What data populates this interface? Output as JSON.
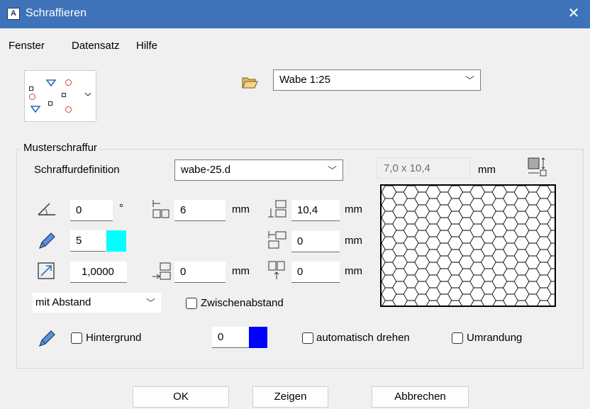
{
  "window": {
    "title": "Schraffieren",
    "app_icon": "A",
    "close_glyph": "✕"
  },
  "menu": [
    "Fenster",
    "Datensatz",
    "Hilfe"
  ],
  "preset": {
    "selected": "Wabe 1:25"
  },
  "group": {
    "title": "Musterschraffur",
    "definition_label": "Schraffurdefinition",
    "definition_value": "wabe-25.d",
    "size_value": "7,0 x 10,4",
    "size_unit": "mm"
  },
  "fields": {
    "angle": "0",
    "angle_unit": "°",
    "pen": "5",
    "scale": "1,0000",
    "width": "6",
    "width_unit": "mm",
    "offset": "0",
    "offset_unit": "mm",
    "height": "10,4",
    "height_unit": "mm",
    "spacing_x": "0",
    "spacing_x_unit": "mm",
    "spacing_y": "0",
    "spacing_y_unit": "mm"
  },
  "spacing_mode": "mit Abstand",
  "checkboxes": {
    "zwischenabstand": "Zwischenabstand",
    "hintergrund": "Hintergrund",
    "auto_rotate": "automatisch drehen",
    "border": "Umrandung"
  },
  "background_color_value": "0",
  "colors": {
    "pen_swatch": "#00ffff",
    "background_swatch": "#0000ff",
    "accent": "#3e73b9"
  },
  "buttons": {
    "ok": "OK",
    "show": "Zeigen",
    "cancel": "Abbrechen"
  }
}
